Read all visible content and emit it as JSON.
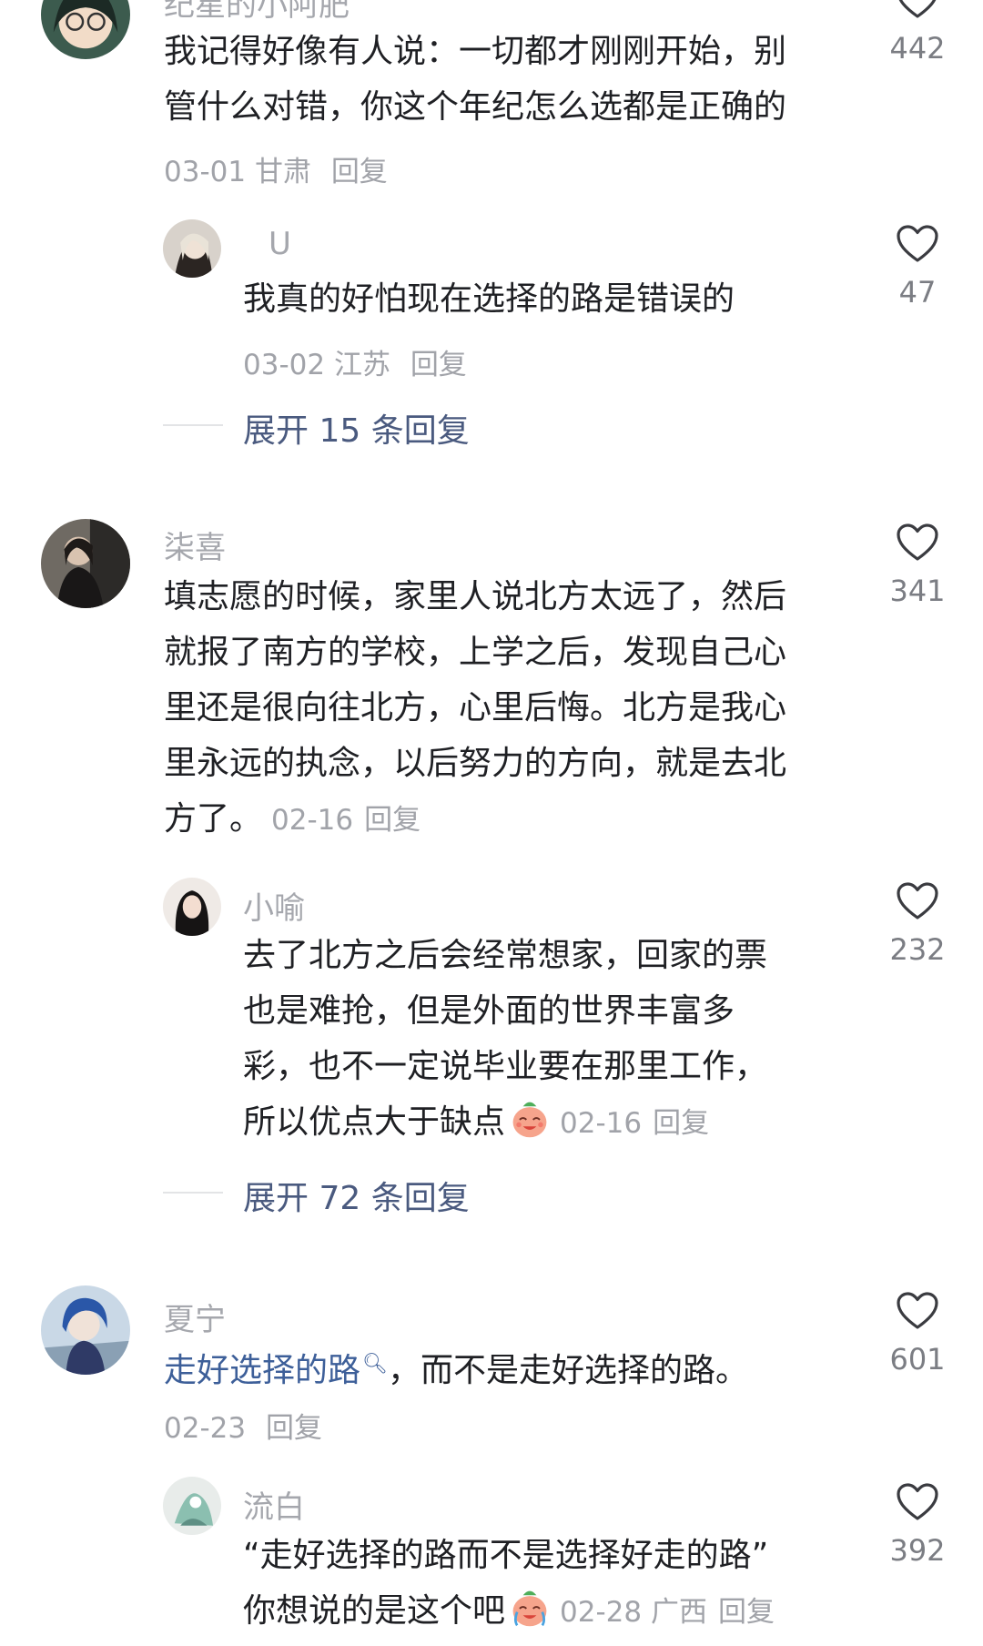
{
  "comments": [
    {
      "user": "纪星的小阿肥",
      "text_lines": [
        "我记得好像有人说：一切都才刚刚开始，别",
        "管什么对错，你这个年纪怎么选都是正确的"
      ],
      "date": "03-01",
      "location": "甘肃",
      "reply_label": "回复",
      "likes": "442",
      "replies": [
        {
          "user": "U",
          "text_lines": [
            "我真的好怕现在选择的路是错误的"
          ],
          "date": "03-02",
          "location": "江苏",
          "reply_label": "回复",
          "likes": "47"
        }
      ],
      "expand_label": "展开 15 条回复"
    },
    {
      "user": "柒喜",
      "text_lines": [
        "填志愿的时候，家里人说北方太远了，然后",
        "就报了南方的学校，上学之后，发现自己心",
        "里还是很向往北方，心里后悔。北方是我心",
        "里永远的执念，以后努力的方向，就是去北",
        "方了。"
      ],
      "date": "02-16",
      "reply_label": "回复",
      "likes": "341",
      "replies": [
        {
          "user": "小喻",
          "text_lines": [
            "去了北方之后会经常想家，回家的票",
            "也是难抢，但是外面的世界丰富多",
            "彩，也不一定说毕业要在那里工作，",
            "所以优点大于缺点"
          ],
          "emoji": "smiling-face-emoji",
          "date": "02-16",
          "reply_label": "回复",
          "likes": "232"
        }
      ],
      "expand_label": "展开 72 条回复"
    },
    {
      "user": "夏宁",
      "link_text": "走好选择的路",
      "text_after_link": "，而不是走好选择的路。",
      "date": "02-23",
      "reply_label": "回复",
      "likes": "601",
      "replies": [
        {
          "user": "流白",
          "text_lines": [
            "“走好选择的路而不是选择好走的路”",
            "你想说的是这个吧"
          ],
          "emoji": "crying-laughing-emoji",
          "date": "02-28",
          "location": "广西",
          "reply_label": "回复",
          "likes": "392"
        }
      ]
    }
  ],
  "colors": {
    "username": "#a5a7ad",
    "meta": "#a1a3a9",
    "expand": "#4a5a7f",
    "link": "#3d5f99"
  }
}
